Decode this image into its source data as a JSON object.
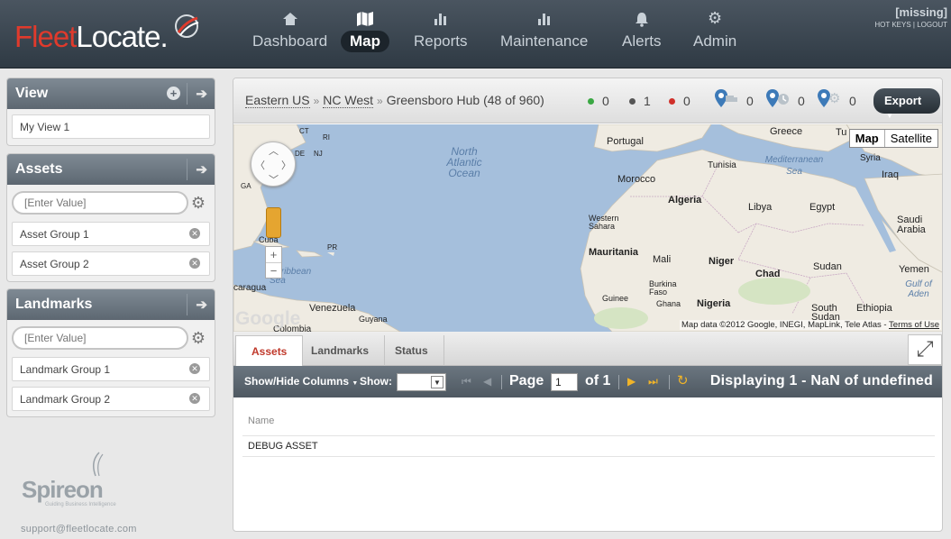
{
  "header": {
    "logo_fleet": "Fleet",
    "logo_locate": "Locate",
    "logo_tm": ".",
    "nav": [
      {
        "label": "Dashboard",
        "icon": "home-icon",
        "active": false
      },
      {
        "label": "Map",
        "icon": "map-icon",
        "active": true
      },
      {
        "label": "Reports",
        "icon": "bar-chart-icon",
        "active": false
      },
      {
        "label": "Maintenance",
        "icon": "bar-chart-icon",
        "active": false
      },
      {
        "label": "Alerts",
        "icon": "bell-icon",
        "active": false
      },
      {
        "label": "Admin",
        "icon": "gear-icon",
        "active": false
      }
    ],
    "user": "[missing]",
    "hotkeys": "HOT KEYS",
    "logout": "LOGOUT"
  },
  "sidebar": {
    "view": {
      "title": "View",
      "items": [
        "My View 1"
      ]
    },
    "assets": {
      "title": "Assets",
      "placeholder": "[Enter Value]",
      "items": [
        "Asset Group 1",
        "Asset Group 2"
      ]
    },
    "landmarks": {
      "title": "Landmarks",
      "placeholder": "[Enter Value]",
      "items": [
        "Landmark Group 1",
        "Landmark Group 2"
      ]
    },
    "brand": "Spireon",
    "brand_tagline": "Guiding Business Intelligence",
    "support": "support@fleetlocate.com"
  },
  "toolbar": {
    "crumbs": [
      "Eastern US",
      "NC West"
    ],
    "current": "Greensboro Hub (48 of 960)",
    "status_counts": [
      {
        "color": "#3aa843",
        "value": "0"
      },
      {
        "color": "#555555",
        "value": "1"
      },
      {
        "color": "#d0302a",
        "value": "0"
      }
    ],
    "pin_counts": [
      "0",
      "0",
      "0"
    ],
    "export": "Export"
  },
  "map": {
    "type_map": "Map",
    "type_satellite": "Satellite",
    "attribution": "Map data ©2012 Google, INEGI, MapLink, Tele Atlas - ",
    "terms": "Terms of Use",
    "google": "Google",
    "labels": {
      "portugal": "Portugal",
      "greece": "Greece",
      "tunisia": "Tunisia",
      "syria": "Syria",
      "mediterranean": "Mediterranean Sea",
      "iraq": "Iraq",
      "morocco": "Morocco",
      "algeria": "Algeria",
      "libya": "Libya",
      "egypt": "Egypt",
      "saudi": "Saudi Arabia",
      "western_sahara": "Western Sahara",
      "mauritania": "Mauritania",
      "mali": "Mali",
      "niger": "Niger",
      "chad": "Chad",
      "sudan": "Sudan",
      "yemen": "Yemen",
      "gulf_aden": "Gulf of Aden",
      "burkina": "Burkina Faso",
      "guinee": "Guinee",
      "ghana": "Ghana",
      "nigeria": "Nigeria",
      "south_sudan": "South Sudan",
      "ethiopia": "Ethiopia",
      "north_atlantic": "North Atlantic Ocean",
      "venezuela": "Venezuela",
      "guyana": "Guyana",
      "cuba": "Cuba",
      "caribbean": "Caribbean Sea",
      "pr": "PR",
      "ga": "GA",
      "ct": "CT",
      "ri": "RI",
      "nj": "NJ",
      "de": "DE",
      "caragua": "caragua",
      "colombia": "Colombia",
      "tu": "Tu"
    }
  },
  "tabs": [
    {
      "label": "Assets",
      "active": true
    },
    {
      "label": "Landmarks",
      "active": false
    },
    {
      "label": "Status",
      "active": false
    }
  ],
  "grid": {
    "show_hide": "Show/Hide Columns",
    "show": "Show:",
    "page": "Page",
    "page_value": "1",
    "of": "of 1",
    "display": "Displaying 1 - NaN of undefined",
    "column_header": "Name",
    "rows": [
      "DEBUG ASSET"
    ]
  }
}
